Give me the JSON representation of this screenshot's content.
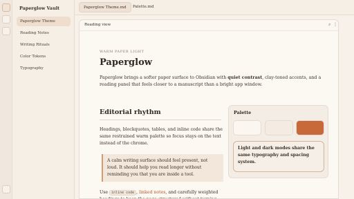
{
  "app": {
    "vault_name": "Paperglow Vault"
  },
  "sidebar": {
    "items": [
      {
        "label": "Paperglow Theme",
        "active": true
      },
      {
        "label": "Reading Notes",
        "active": false
      },
      {
        "label": "Writing Rituals",
        "active": false
      },
      {
        "label": "Color Tokens",
        "active": false
      },
      {
        "label": "Typography",
        "active": false
      }
    ]
  },
  "tabs": [
    {
      "label": "Paperglow Theme.md",
      "active": true
    },
    {
      "label": "Palette.md",
      "active": false
    }
  ],
  "panel": {
    "title": "Reading view",
    "search_icon": "search-icon",
    "more_icon": "more-vertical-icon"
  },
  "doc": {
    "eyebrow": "WARM PAPER LIGHT",
    "title": "Paperglow",
    "intro_a": "Paperglow brings a softer paper surface to Obsidian with ",
    "intro_bold": "quiet contrast",
    "intro_b": ", clay-toned accents, and a reading panel that feels closer to a manuscript than a bright app window.",
    "section_title": "Editorial rhythm",
    "section_para": "Headings, blockquotes, tables, and inline code share the same restrained warm palette so focus stays on the text instead of the chrome.",
    "quote": "A calm writing surface should feel present, not loud. It should help you read longer without reminding you that you are inside a tool.",
    "use_a": "Use ",
    "inline_code": "inline code",
    "use_sep": ", ",
    "link_text": "linked notes",
    "use_b": ", and carefully weighted headings to keep the page structured without turning"
  },
  "palette": {
    "title": "Palette",
    "swatches": [
      "#fbf6ef",
      "#f4ece3",
      "#c8693a"
    ],
    "note": "Light and dark modes share the same typography and spacing system."
  }
}
